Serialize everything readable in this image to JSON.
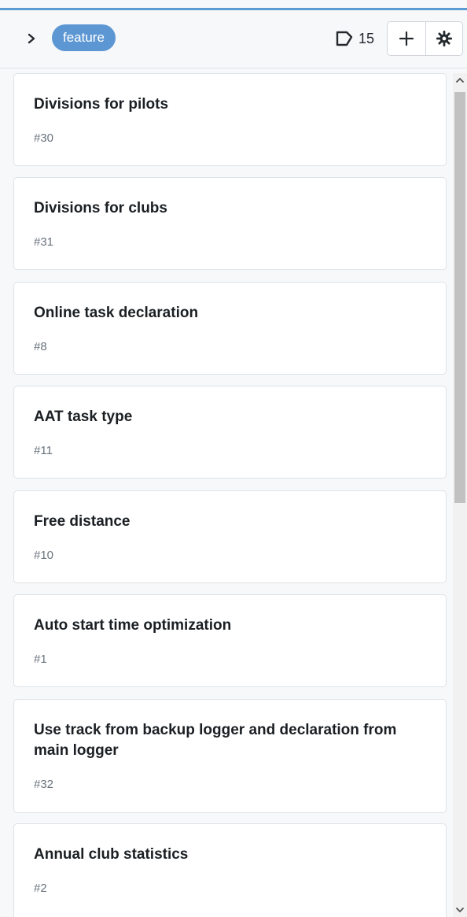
{
  "header": {
    "label": "feature",
    "label_color": "#5d97d3",
    "issue_count": "15",
    "icons": {
      "collapse": "chevron-right-icon",
      "issues": "issue-card-icon",
      "add": "plus-icon",
      "settings": "gear-icon"
    }
  },
  "cards": [
    {
      "title": "Divisions for pilots",
      "number": "#30"
    },
    {
      "title": "Divisions for clubs",
      "number": "#31"
    },
    {
      "title": "Online task declaration",
      "number": "#8"
    },
    {
      "title": "AAT task type",
      "number": "#11"
    },
    {
      "title": "Free distance",
      "number": "#10"
    },
    {
      "title": "Auto start time optimization",
      "number": "#1"
    },
    {
      "title": "Use track from backup logger and declaration from main logger",
      "number": "#32"
    },
    {
      "title": "Annual club statistics",
      "number": "#2"
    }
  ]
}
